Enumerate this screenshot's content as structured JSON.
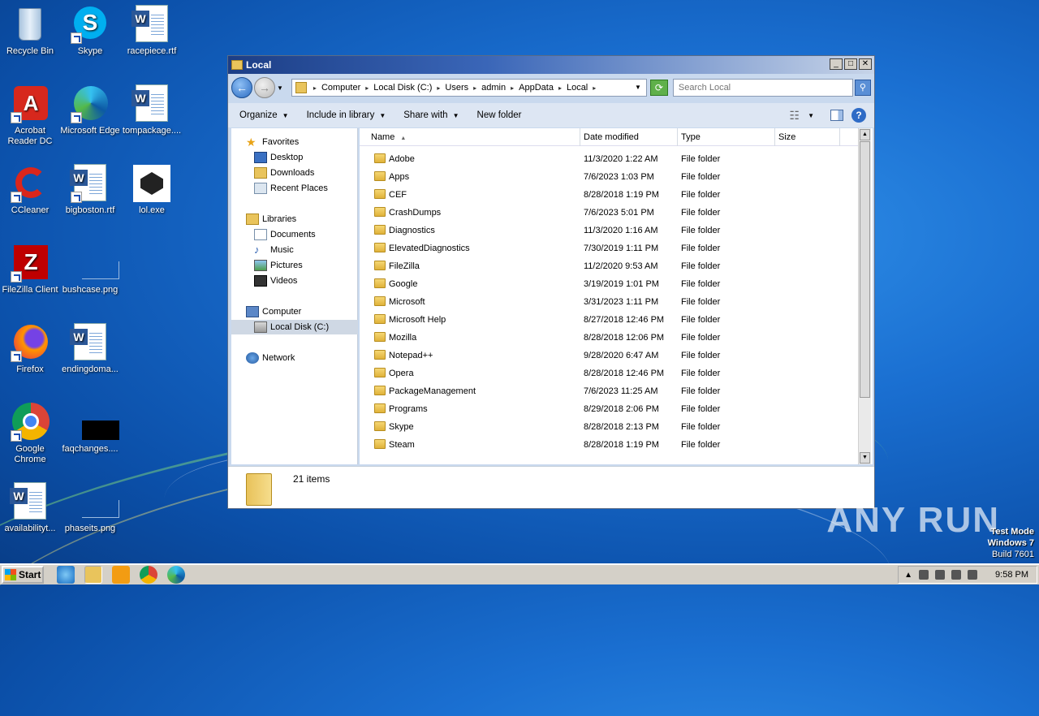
{
  "desktop": {
    "icons": [
      {
        "label": "Recycle Bin"
      },
      {
        "label": "Skype"
      },
      {
        "label": "racepiece.rtf"
      },
      {
        "label": "Acrobat Reader DC"
      },
      {
        "label": "Microsoft Edge"
      },
      {
        "label": "tompackage...."
      },
      {
        "label": "CCleaner"
      },
      {
        "label": "bigboston.rtf"
      },
      {
        "label": "lol.exe"
      },
      {
        "label": "FileZilla Client"
      },
      {
        "label": "bushcase.png"
      },
      {
        "label": "Firefox"
      },
      {
        "label": "endingdoma..."
      },
      {
        "label": "Google Chrome"
      },
      {
        "label": "faqchanges...."
      },
      {
        "label": "availabilityt..."
      },
      {
        "label": "phaseits.png"
      }
    ]
  },
  "window": {
    "title": "Local",
    "buttons": {
      "minimize": "_",
      "maximize": "□",
      "close": "✕"
    },
    "address": [
      "Computer",
      "Local Disk (C:)",
      "Users",
      "admin",
      "AppData",
      "Local"
    ],
    "search_placeholder": "Search Local",
    "toolbar": {
      "organize": "Organize",
      "include": "Include in library",
      "share": "Share with",
      "new_folder": "New folder"
    },
    "nav": {
      "favorites": "Favorites",
      "desktop": "Desktop",
      "downloads": "Downloads",
      "recent": "Recent Places",
      "libraries": "Libraries",
      "documents": "Documents",
      "music": "Music",
      "pictures": "Pictures",
      "videos": "Videos",
      "computer": "Computer",
      "localdisk": "Local Disk (C:)",
      "network": "Network"
    },
    "columns": {
      "name": "Name",
      "date": "Date modified",
      "type": "Type",
      "size": "Size"
    },
    "rows": [
      {
        "name": "Adobe",
        "date": "11/3/2020 1:22 AM",
        "type": "File folder"
      },
      {
        "name": "Apps",
        "date": "7/6/2023 1:03 PM",
        "type": "File folder"
      },
      {
        "name": "CEF",
        "date": "8/28/2018 1:19 PM",
        "type": "File folder"
      },
      {
        "name": "CrashDumps",
        "date": "7/6/2023 5:01 PM",
        "type": "File folder"
      },
      {
        "name": "Diagnostics",
        "date": "11/3/2020 1:16 AM",
        "type": "File folder"
      },
      {
        "name": "ElevatedDiagnostics",
        "date": "7/30/2019 1:11 PM",
        "type": "File folder"
      },
      {
        "name": "FileZilla",
        "date": "11/2/2020 9:53 AM",
        "type": "File folder"
      },
      {
        "name": "Google",
        "date": "3/19/2019 1:01 PM",
        "type": "File folder"
      },
      {
        "name": "Microsoft",
        "date": "3/31/2023 1:11 PM",
        "type": "File folder"
      },
      {
        "name": "Microsoft Help",
        "date": "8/27/2018 12:46 PM",
        "type": "File folder"
      },
      {
        "name": "Mozilla",
        "date": "8/28/2018 12:06 PM",
        "type": "File folder"
      },
      {
        "name": "Notepad++",
        "date": "9/28/2020 6:47 AM",
        "type": "File folder"
      },
      {
        "name": "Opera",
        "date": "8/28/2018 12:46 PM",
        "type": "File folder"
      },
      {
        "name": "PackageManagement",
        "date": "7/6/2023 11:25 AM",
        "type": "File folder"
      },
      {
        "name": "Programs",
        "date": "8/29/2018 2:06 PM",
        "type": "File folder"
      },
      {
        "name": "Skype",
        "date": "8/28/2018 2:13 PM",
        "type": "File folder"
      },
      {
        "name": "Steam",
        "date": "8/28/2018 1:19 PM",
        "type": "File folder"
      }
    ],
    "status": "21 items"
  },
  "taskbar": {
    "start": "Start",
    "clock": "9:58 PM"
  },
  "watermark": "ANY RUN",
  "testmode": {
    "line1": "Test Mode",
    "line2": "Windows 7",
    "line3": "Build 7601"
  }
}
